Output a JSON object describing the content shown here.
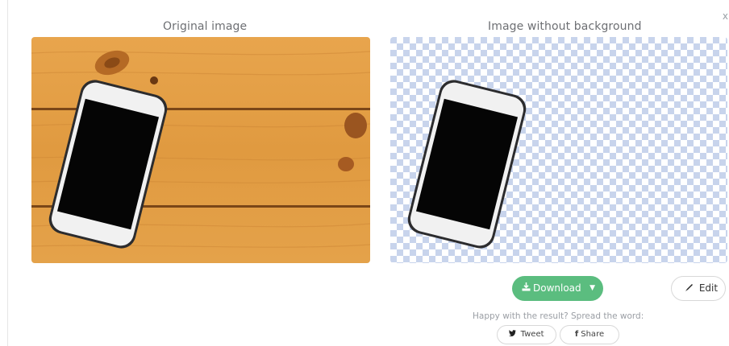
{
  "header": {
    "original_title": "Original image",
    "result_title": "Image without background",
    "close_glyph": "x"
  },
  "actions": {
    "download_label": "Download",
    "edit_label": "Edit"
  },
  "share": {
    "prompt": "Happy with the result? Spread the word:",
    "tweet_label": "Tweet",
    "share_label": "Share"
  },
  "colors": {
    "download_green": "#5bbd7f",
    "wood": "#e3a04a",
    "checker": "#c8d4ec"
  }
}
